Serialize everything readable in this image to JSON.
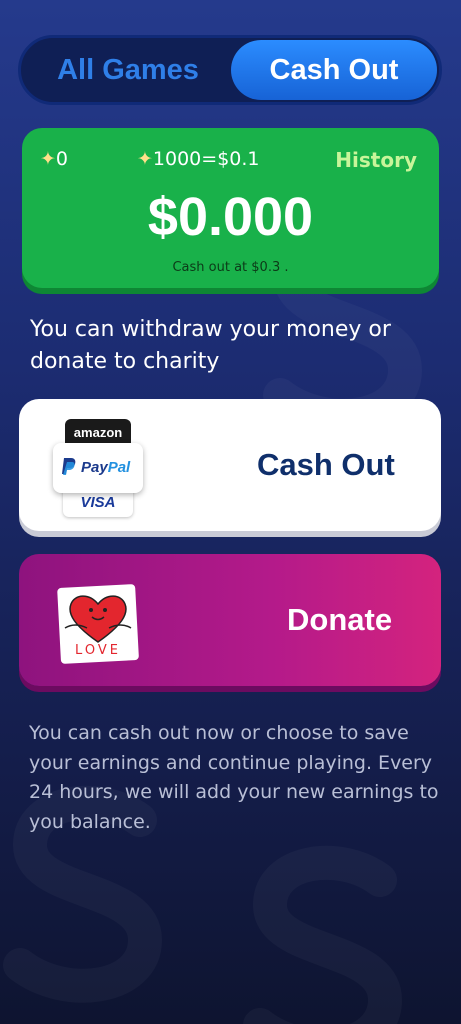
{
  "tabs": {
    "all_games": "All Games",
    "cash_out": "Cash Out",
    "active": "cash_out"
  },
  "balance": {
    "points": "0",
    "rate": "1000=$0.1",
    "history_label": "History",
    "amount": "$0.000",
    "cashout_threshold": "Cash out at  $0.3 ."
  },
  "intro_text": "You can withdraw your money or donate to charity",
  "options": {
    "cash_out": {
      "label": "Cash Out",
      "logos": {
        "amazon": "amazon",
        "paypal_pay": "Pay",
        "paypal_pal": "Pal",
        "visa": "VISA"
      }
    },
    "donate": {
      "label": "Donate",
      "icon_text": "LOVE"
    }
  },
  "footer_text": "You can cash out now or choose to save your earnings and continue playing. Every 24 hours, we will add your new earnings to you balance.",
  "colors": {
    "background_top": "#253a8c",
    "balance_green": "#19b14a",
    "history_green": "#c8f59a",
    "tab_active": "#2b8cff",
    "donate_purple": "#b41a8a",
    "cash_out_text": "#0f2f6b"
  },
  "icons": [
    "star-icon",
    "amazon-logo",
    "paypal-logo",
    "visa-logo",
    "love-heart-icon",
    "dollar-sign-decoration"
  ]
}
